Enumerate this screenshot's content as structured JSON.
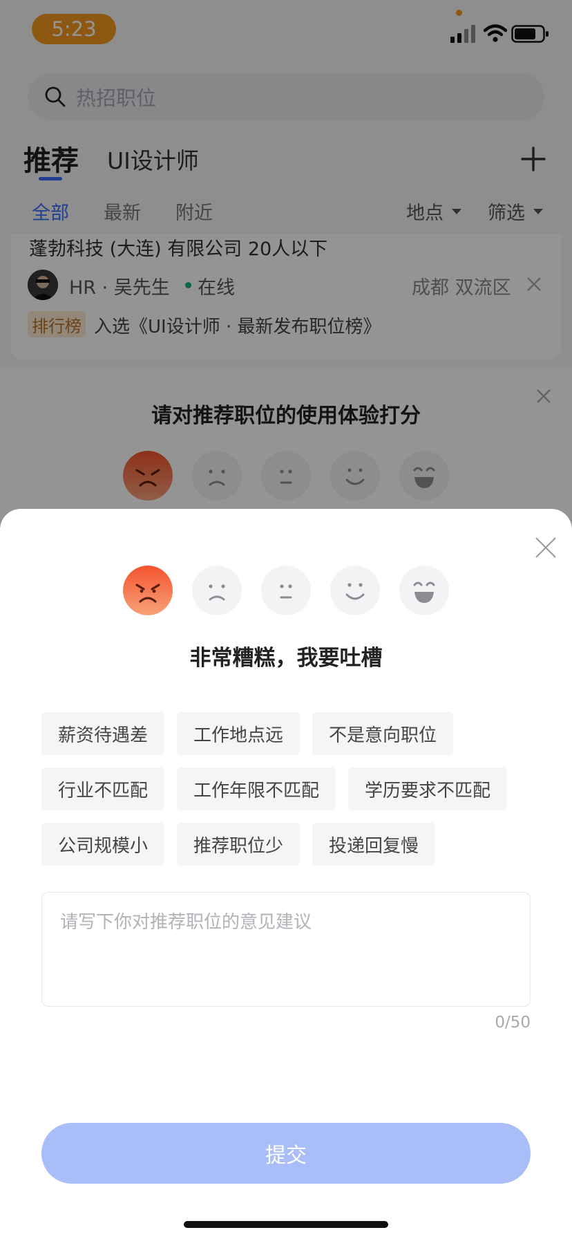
{
  "status_bar": {
    "time": "5:23"
  },
  "search": {
    "placeholder": "热招职位"
  },
  "top_tabs": {
    "main": "推荐",
    "second": "UI设计师"
  },
  "filters": {
    "all": "全部",
    "latest": "最新",
    "nearby": "附近",
    "location": "地点",
    "screen": "筛选"
  },
  "job_card": {
    "company": "蓬勃科技 (大连) 有限公司  20人以下",
    "hr": "HR · 吴先生",
    "online": "在线",
    "location": "成都  双流区",
    "rank_badge": "排行榜",
    "rank_text": "入选《UI设计师 · 最新发布职位榜》"
  },
  "rating_card": {
    "title": "请对推荐职位的使用体验打分"
  },
  "sheet": {
    "title": "非常糟糕，我要吐槽",
    "tags": [
      "薪资待遇差",
      "工作地点远",
      "不是意向职位",
      "行业不匹配",
      "工作年限不匹配",
      "学历要求不匹配",
      "公司规模小",
      "推荐职位少",
      "投递回复慢"
    ],
    "feedback_placeholder": "请写下你对推荐职位的意见建议",
    "counter": "0/50",
    "submit": "提交"
  },
  "colors": {
    "accent": "#3b6cf6",
    "angry_face": "#f0643a",
    "submit_disabled": "#a9bdf8"
  },
  "icons": [
    "search-icon",
    "plus-icon",
    "close-icon",
    "angry-face-icon",
    "sad-face-icon",
    "neutral-face-icon",
    "smile-face-icon",
    "laugh-face-icon"
  ]
}
